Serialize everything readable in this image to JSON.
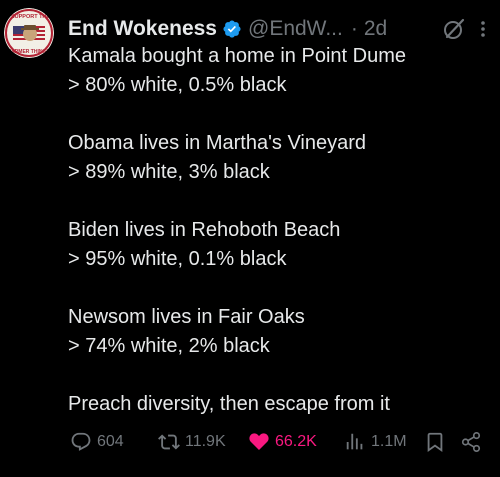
{
  "author": {
    "name": "End Wokeness",
    "handle": "@EndW...",
    "separator": "·",
    "time": "2d",
    "avatar_top_text": "I SUPPORT THE",
    "avatar_bottom_text": "FARMER THINGS"
  },
  "tweet": {
    "lines": [
      "Kamala bought a home in Point Dume",
      "> 80% white, 0.5% black",
      "",
      "Obama lives in Martha's Vineyard",
      "> 89% white, 3% black",
      "",
      "Biden lives in Rehoboth Beach",
      "> 95% white, 0.1% black",
      "",
      "Newsom lives in Fair Oaks",
      "> 74% white, 2% black",
      "",
      "Preach diversity, then escape from it"
    ]
  },
  "actions": {
    "replies": "604",
    "reposts": "11.9K",
    "likes": "66.2K",
    "views": "1.1M"
  },
  "colors": {
    "background": "#000000",
    "text": "#e7e9ea",
    "muted": "#71767b",
    "like": "#f91880",
    "verified": "#1d9bf0"
  }
}
